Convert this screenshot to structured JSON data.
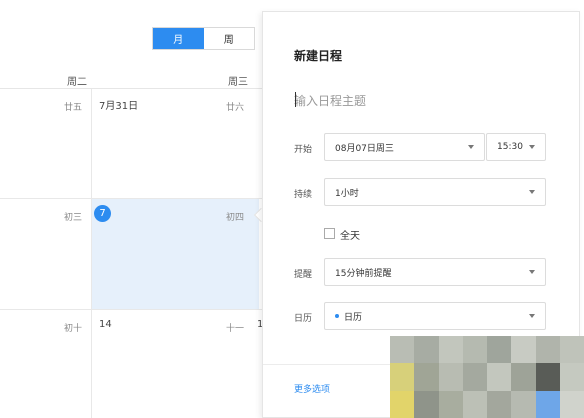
{
  "view_toggle": {
    "month": "月",
    "week": "周"
  },
  "weekdays": [
    "周二",
    "周三"
  ],
  "calendar": {
    "row1": {
      "lunar_left": "廿五",
      "date_mid": "7月31日",
      "lunar_mid": "廿六"
    },
    "row2": {
      "lunar_left": "初三",
      "today": "7",
      "lunar_mid": "初四"
    },
    "row3": {
      "lunar_left": "初十",
      "date_mid": "14",
      "lunar_mid": "十一",
      "partial": "1"
    }
  },
  "panel": {
    "title": "新建日程",
    "subject_placeholder": "输入日程主题",
    "start_label": "开始",
    "start_date": "08月07日周三",
    "start_time": "15:30",
    "duration_label": "持续",
    "duration_value": "1小时",
    "allday_label": "全天",
    "reminder_label": "提醒",
    "reminder_value": "15分钟前提醒",
    "calendar_label": "日历",
    "calendar_value": "日历",
    "more_options": "更多选项"
  },
  "colors": {
    "accent": "#2d8cf0",
    "selected_cell": "#e6f0fb"
  },
  "blur_colors": [
    "#b9bdb4",
    "#a7aca3",
    "#c2c6bd",
    "#b5bab0",
    "#9fa59c",
    "#c8cbc3",
    "#b0b4ab",
    "#bfc3ba",
    "#d7d07a",
    "#a0a596",
    "#b8bcb2",
    "#a4a99f",
    "#c3c7be",
    "#9ea398",
    "#595c57",
    "#c5c9c0",
    "#e2d46a",
    "#8f948a",
    "#a8ad9f",
    "#bcc0b6",
    "#a3a79d",
    "#b6bab1",
    "#6ea6e8",
    "#d0d3cc"
  ]
}
